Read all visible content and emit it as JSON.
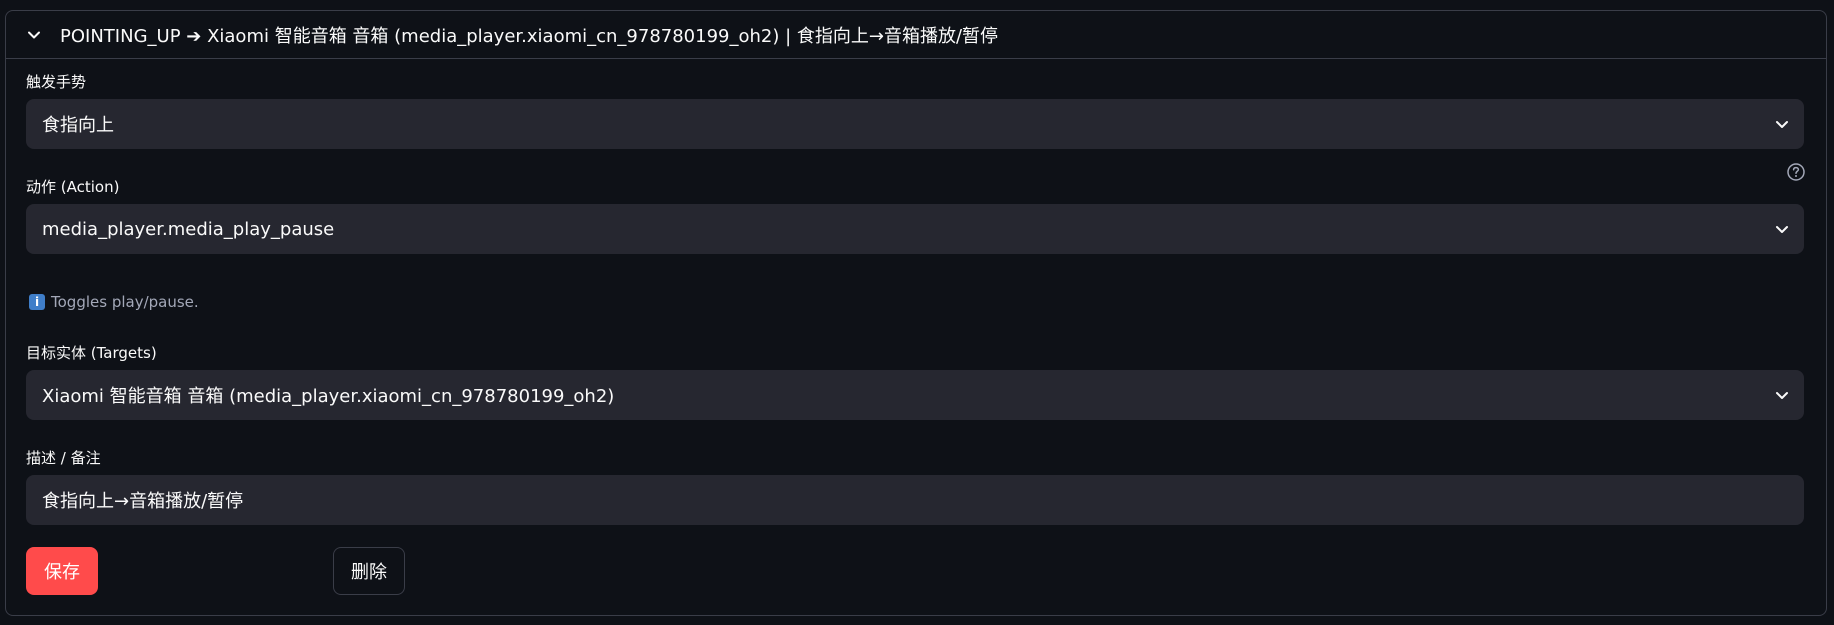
{
  "expander": {
    "title": "POINTING_UP ➔ Xiaomi 智能音箱 音箱 (media_player.xiaomi_cn_978780199_oh2) | 食指向上→音箱播放/暂停",
    "icon": "chevron-down-icon"
  },
  "fields": {
    "gesture": {
      "label": "触发手势",
      "value": "食指向上"
    },
    "action": {
      "label": "动作 (Action)",
      "value": "media_player.media_play_pause",
      "help_icon": "question-circle-icon",
      "caption_icon": "info-icon",
      "caption_icon_glyph": "i",
      "caption": "Toggles play/pause."
    },
    "targets": {
      "label": "目标实体 (Targets)",
      "value": "Xiaomi 智能音箱 音箱 (media_player.xiaomi_cn_978780199_oh2)"
    },
    "description": {
      "label": "描述 / 备注",
      "value": "食指向上→音箱播放/暂停"
    }
  },
  "buttons": {
    "save_label": "保存",
    "delete_label": "删除"
  },
  "colors": {
    "background": "#0e1117",
    "input_background": "#262730",
    "primary": "#ff4b4b",
    "border": "#3a3d48",
    "info": "#3f7ec9"
  }
}
